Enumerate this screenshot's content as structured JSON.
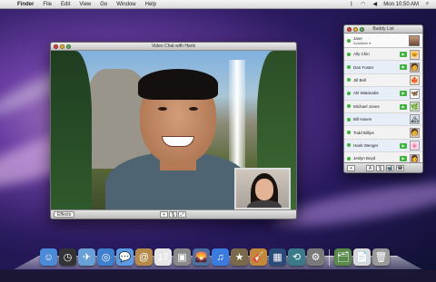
{
  "menubar": {
    "apple": "",
    "items": [
      "Finder",
      "File",
      "Edit",
      "View",
      "Go",
      "Window",
      "Help"
    ],
    "clock": "Mon 10:50 AM",
    "status_icons": [
      "bluetooth-icon",
      "wifi-icon",
      "volume-icon",
      "spotlight-icon"
    ]
  },
  "video_window": {
    "title": "Video Chat with Hank",
    "effects_label": "Effects",
    "controls": [
      "+",
      "🎙",
      "⤢"
    ]
  },
  "buddy_list": {
    "title": "Buddy List",
    "me": {
      "name": "Jane",
      "status": "Available ▾"
    },
    "buddies": [
      {
        "name": "Ally Chin",
        "video": true,
        "avatar": "🐱",
        "avatar_bg": "#f0d6b8"
      },
      {
        "name": "Dan Foster",
        "video": true,
        "avatar": "🧑",
        "avatar_bg": "#c9a98a"
      },
      {
        "name": "Jill Bell",
        "video": false,
        "avatar": "🍁",
        "avatar_bg": "#f4e2c0"
      },
      {
        "name": "Aki Watanabe",
        "video": true,
        "avatar": "🦋",
        "avatar_bg": "#ffffff"
      },
      {
        "name": "Michael Jones",
        "video": true,
        "avatar": "🌿",
        "avatar_bg": "#cfe7c8"
      },
      {
        "name": "Bill Haven",
        "video": false,
        "avatar": "🏔",
        "avatar_bg": "#d4dde8"
      },
      {
        "name": "Todd Billips",
        "video": false,
        "avatar": "🧑",
        "avatar_bg": "#e0c4b0"
      },
      {
        "name": "Hank Wenger",
        "video": true,
        "avatar": "🌸",
        "avatar_bg": "#fbe3ef"
      },
      {
        "name": "Jeslyn Boyd",
        "video": true,
        "avatar": "👩",
        "avatar_bg": "#e8c9b8"
      }
    ],
    "bottom_buttons": [
      "+",
      "A",
      "🎙",
      "📹",
      "☎"
    ]
  },
  "dock": {
    "apps": [
      {
        "name": "finder-icon",
        "glyph": "☺",
        "color": "#4a8ad8"
      },
      {
        "name": "dashboard-icon",
        "glyph": "◷",
        "color": "#333333"
      },
      {
        "name": "mail-icon",
        "glyph": "✈",
        "color": "#6aa0d8"
      },
      {
        "name": "safari-icon",
        "glyph": "◎",
        "color": "#3f7fd0"
      },
      {
        "name": "ichat-icon",
        "glyph": "💬",
        "color": "#5b9be6"
      },
      {
        "name": "address-book-icon",
        "glyph": "@",
        "color": "#b58a4a"
      },
      {
        "name": "ical-icon",
        "glyph": "17",
        "color": "#e6e6e6"
      },
      {
        "name": "preview-icon",
        "glyph": "▣",
        "color": "#8a8a8a"
      },
      {
        "name": "iphoto-icon",
        "glyph": "🌄",
        "color": "#4b6fa0"
      },
      {
        "name": "itunes-icon",
        "glyph": "♫",
        "color": "#3a7be0"
      },
      {
        "name": "imovie-icon",
        "glyph": "★",
        "color": "#7a6a4a"
      },
      {
        "name": "garageband-icon",
        "glyph": "🎸",
        "color": "#c4883a"
      },
      {
        "name": "spaces-icon",
        "glyph": "▦",
        "color": "#2a4a7a"
      },
      {
        "name": "time-machine-icon",
        "glyph": "⟲",
        "color": "#3a7a8a"
      },
      {
        "name": "system-preferences-icon",
        "glyph": "⚙",
        "color": "#7a7a7a"
      }
    ],
    "stacks": [
      {
        "name": "applications-stack-icon",
        "glyph": "🗂",
        "color": "#5a8a4a"
      },
      {
        "name": "documents-stack-icon",
        "glyph": "📄",
        "color": "#d9d9d9"
      },
      {
        "name": "trash-icon",
        "glyph": "🗑",
        "color": "#9a9a9a"
      }
    ]
  }
}
